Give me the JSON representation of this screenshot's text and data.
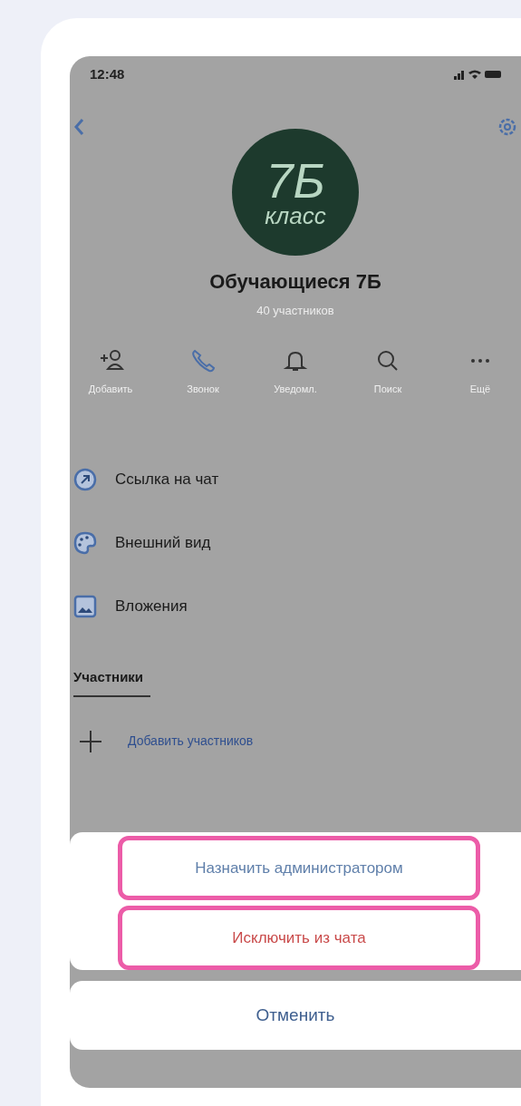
{
  "status_bar": {
    "time": "12:48"
  },
  "chat": {
    "avatar_lines": [
      "7Б",
      "класс"
    ],
    "title": "Обучающиеся 7Б",
    "subtitle": "40 участников"
  },
  "actions": [
    {
      "kind": "add-user",
      "label": "Добавить"
    },
    {
      "kind": "call",
      "label": "Звонок"
    },
    {
      "kind": "bell",
      "label": "Уведомл."
    },
    {
      "kind": "search",
      "label": "Поиск"
    },
    {
      "kind": "more",
      "label": "Ещё"
    }
  ],
  "menu": [
    {
      "kind": "link",
      "label": "Ссылка на чат"
    },
    {
      "kind": "palette",
      "label": "Внешний вид"
    },
    {
      "kind": "attachments",
      "label": "Вложения"
    }
  ],
  "members": {
    "tab": "Участники",
    "add_label": "Добавить участников"
  },
  "action_sheet": {
    "options": [
      {
        "label": "Назначить администратором",
        "kind": "default",
        "highlighted": true
      },
      {
        "label": "Исключить из чата",
        "kind": "destructive",
        "highlighted": true
      }
    ],
    "cancel": "Отменить"
  }
}
